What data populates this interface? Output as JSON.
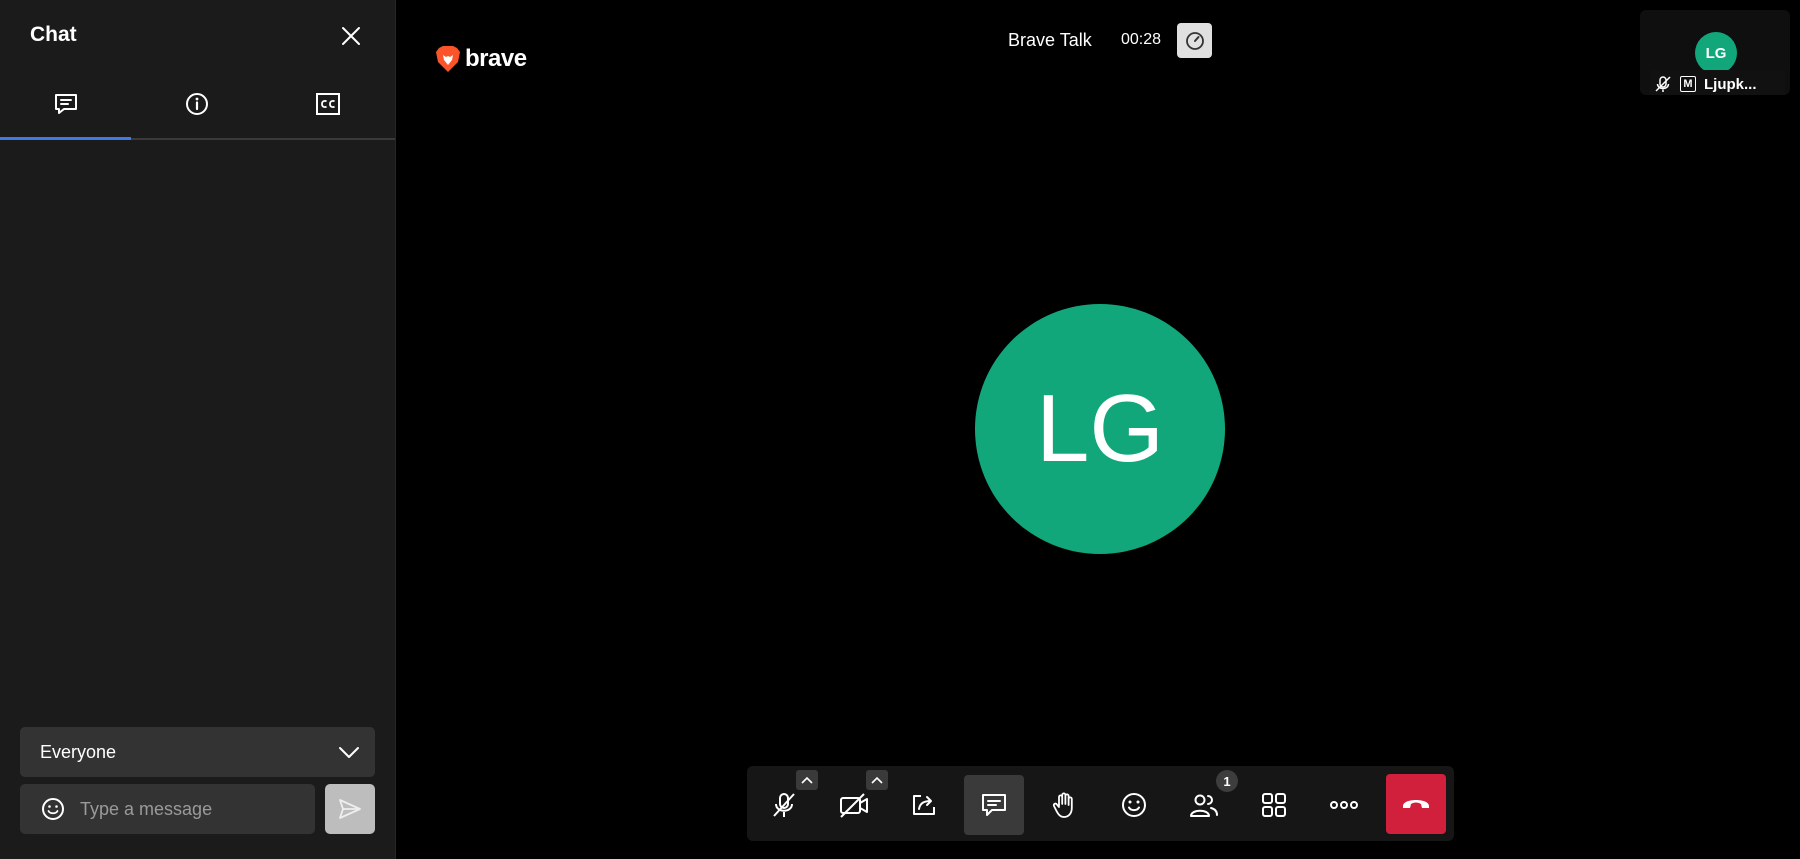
{
  "sidebar": {
    "title": "Chat",
    "close_icon": "close-icon",
    "tabs": [
      {
        "icon": "chat-icon",
        "active": true
      },
      {
        "icon": "info-icon",
        "active": false
      },
      {
        "icon": "closed-captions-icon",
        "active": false
      }
    ],
    "recipient": "Everyone",
    "message_placeholder": "Type a message"
  },
  "header": {
    "logo_text": "brave",
    "conference_name": "Brave Talk",
    "timer": "00:28"
  },
  "participants": {
    "local_initials": "LG",
    "thumb_initials": "LG",
    "thumb_name": "Ljupk...",
    "thumb_moderator_label": "M",
    "count_badge": "1"
  },
  "toolbar": {
    "buttons": [
      "microphone-muted-icon",
      "camera-off-icon",
      "share-screen-icon",
      "chat-icon",
      "raise-hand-icon",
      "reactions-icon",
      "participants-icon",
      "tile-view-icon",
      "more-icon",
      "hangup-icon"
    ]
  },
  "colors": {
    "avatar": "#12a77a",
    "accent_tab": "#3f7ae6",
    "hangup": "#d1203b"
  }
}
